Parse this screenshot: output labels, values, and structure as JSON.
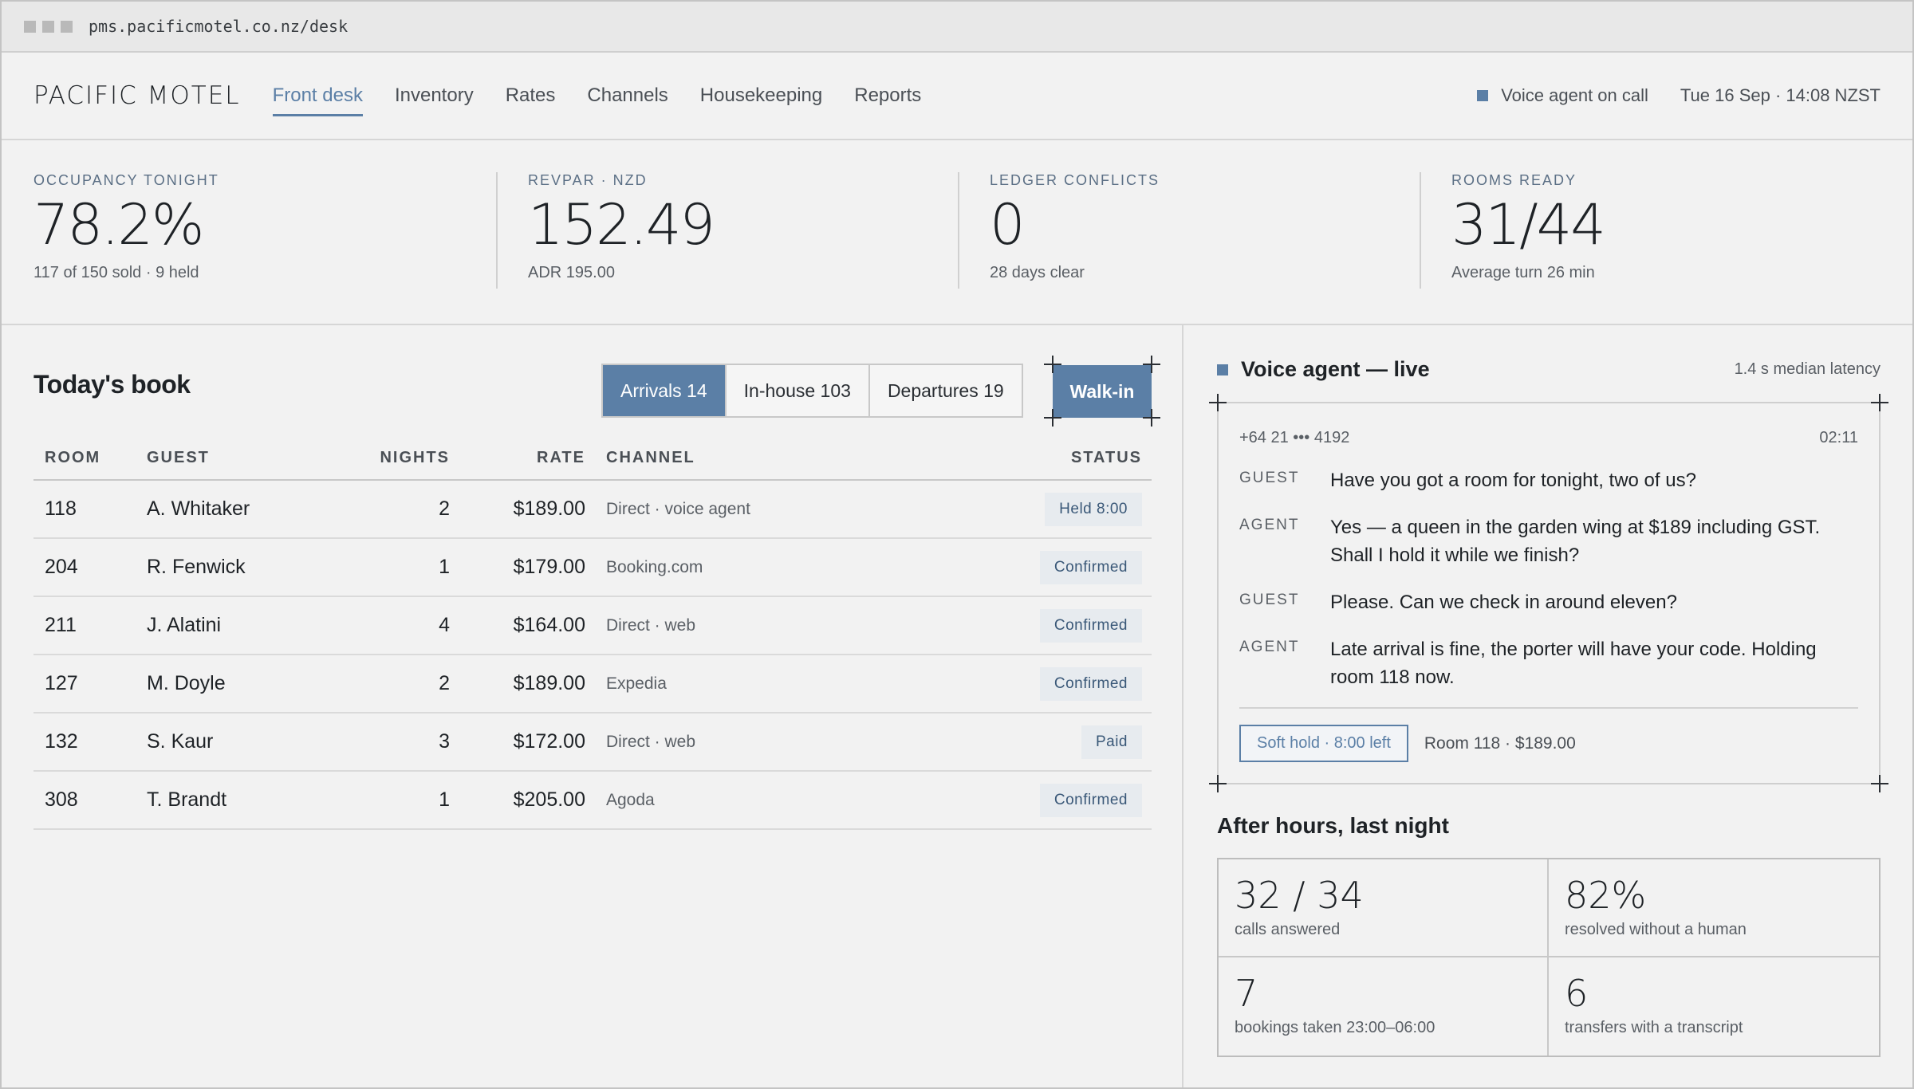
{
  "browser": {
    "url": "pms.pacificmotel.co.nz/desk"
  },
  "nav": {
    "brand": "PACIFIC MOTEL",
    "tabs": [
      "Front desk",
      "Inventory",
      "Rates",
      "Channels",
      "Housekeeping",
      "Reports"
    ],
    "active_tab": "Front desk",
    "voice_status": "Voice agent on call",
    "datetime": "Tue 16 Sep · 14:08 NZST"
  },
  "kpis": [
    {
      "label": "OCCUPANCY TONIGHT",
      "value": "78.2%",
      "sub": "117 of 150 sold · 9 held"
    },
    {
      "label": "REVPAR · NZD",
      "value": "152.49",
      "sub": "ADR 195.00"
    },
    {
      "label": "LEDGER CONFLICTS",
      "value": "0",
      "sub": "28 days clear"
    },
    {
      "label": "ROOMS READY",
      "value": "31/44",
      "sub": "Average turn 26 min"
    }
  ],
  "book": {
    "title": "Today's book",
    "segments": [
      "Arrivals 14",
      "In-house 103",
      "Departures 19"
    ],
    "walkin_label": "Walk-in",
    "columns": [
      "ROOM",
      "GUEST",
      "NIGHTS",
      "RATE",
      "CHANNEL",
      "STATUS"
    ],
    "rows": [
      {
        "room": "118",
        "guest": "A. Whitaker",
        "nights": "2",
        "rate": "$189.00",
        "channel": "Direct · voice agent",
        "status": "Held 8:00"
      },
      {
        "room": "204",
        "guest": "R. Fenwick",
        "nights": "1",
        "rate": "$179.00",
        "channel": "Booking.com",
        "status": "Confirmed"
      },
      {
        "room": "211",
        "guest": "J. Alatini",
        "nights": "4",
        "rate": "$164.00",
        "channel": "Direct · web",
        "status": "Confirmed"
      },
      {
        "room": "127",
        "guest": "M. Doyle",
        "nights": "2",
        "rate": "$189.00",
        "channel": "Expedia",
        "status": "Confirmed"
      },
      {
        "room": "132",
        "guest": "S. Kaur",
        "nights": "3",
        "rate": "$172.00",
        "channel": "Direct · web",
        "status": "Paid"
      },
      {
        "room": "308",
        "guest": "T. Brandt",
        "nights": "1",
        "rate": "$205.00",
        "channel": "Agoda",
        "status": "Confirmed"
      }
    ]
  },
  "voice": {
    "title": "Voice agent — live",
    "latency": "1.4 s median latency",
    "caller": "+64 21 ••• 4192",
    "duration": "02:11",
    "lines": [
      {
        "speaker": "GUEST",
        "text": "Have you got a room for tonight, two of us?"
      },
      {
        "speaker": "AGENT",
        "text": "Yes — a queen in the garden wing at $189 including GST. Shall I hold it while we finish?"
      },
      {
        "speaker": "GUEST",
        "text": "Please. Can we check in around eleven?"
      },
      {
        "speaker": "AGENT",
        "text": "Late arrival is fine, the porter will have your code. Holding room 118 now."
      }
    ],
    "hold_label": "Soft hold · 8:00 left",
    "room_info": "Room 118 · $189.00"
  },
  "after_hours": {
    "title": "After hours, last night",
    "stats": [
      {
        "value": "32 / 34",
        "caption": "calls answered"
      },
      {
        "value": "82%",
        "caption": "resolved without a human"
      },
      {
        "value": "7",
        "caption": "bookings taken 23:00–06:00"
      },
      {
        "value": "6",
        "caption": "transfers with a transcript"
      }
    ]
  },
  "colors": {
    "accent": "#5b7fa6",
    "background": "#f2f2f2",
    "text": "#1e2226"
  }
}
